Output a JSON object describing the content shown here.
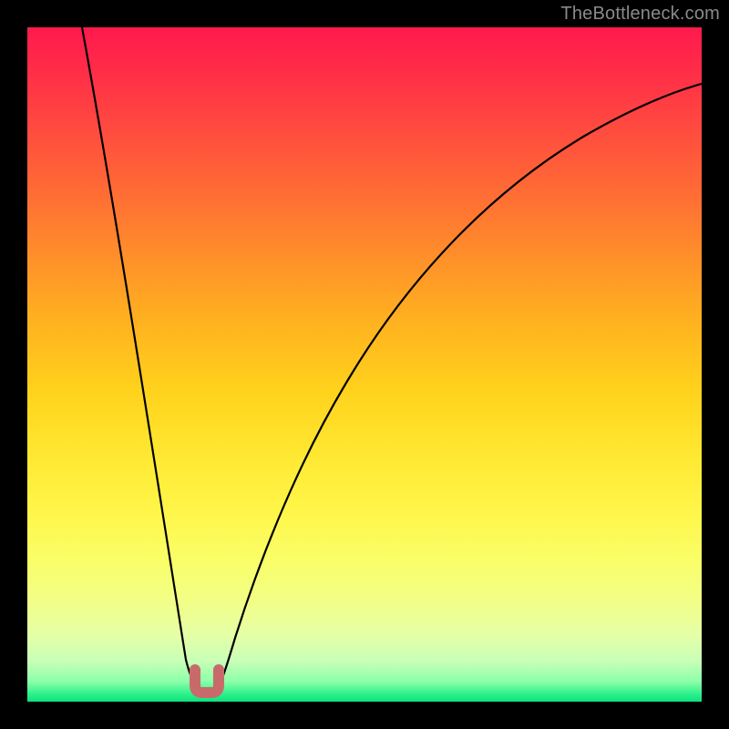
{
  "watermark": "TheBottleneck.com",
  "colors": {
    "frame": "#000000",
    "curve": "#000000",
    "vertex_marker": "#c96a6a",
    "gradient_top": "#ff1a4d",
    "gradient_bottom": "#0de07e"
  },
  "chart_data": {
    "type": "line",
    "title": "",
    "xlabel": "",
    "ylabel": "",
    "xlim": [
      0,
      100
    ],
    "ylim": [
      0,
      100
    ],
    "grid": false,
    "legend": false,
    "note": "Axes are unlabeled; values are estimated from pixel position on a 0-100 normalized scale. y represents the distance above the bottom edge of the plotting area (0 = bottom green band, 100 = top red band).",
    "series": [
      {
        "name": "left-branch",
        "x": [
          8,
          10,
          12,
          14,
          16,
          18,
          20,
          22,
          24,
          25
        ],
        "y": [
          100,
          85,
          71,
          58,
          44,
          32,
          20,
          11,
          4,
          2
        ]
      },
      {
        "name": "right-branch",
        "x": [
          28,
          30,
          32,
          35,
          40,
          45,
          50,
          55,
          60,
          65,
          70,
          75,
          80,
          85,
          90,
          95,
          100
        ],
        "y": [
          2,
          8,
          16,
          26,
          40,
          51,
          59,
          65,
          71,
          75,
          79,
          82,
          84,
          86,
          88,
          89,
          90
        ]
      }
    ],
    "vertex_marker": {
      "approx_x": 26.5,
      "approx_y": 2.5,
      "shape": "U",
      "color": "#c96a6a"
    }
  }
}
